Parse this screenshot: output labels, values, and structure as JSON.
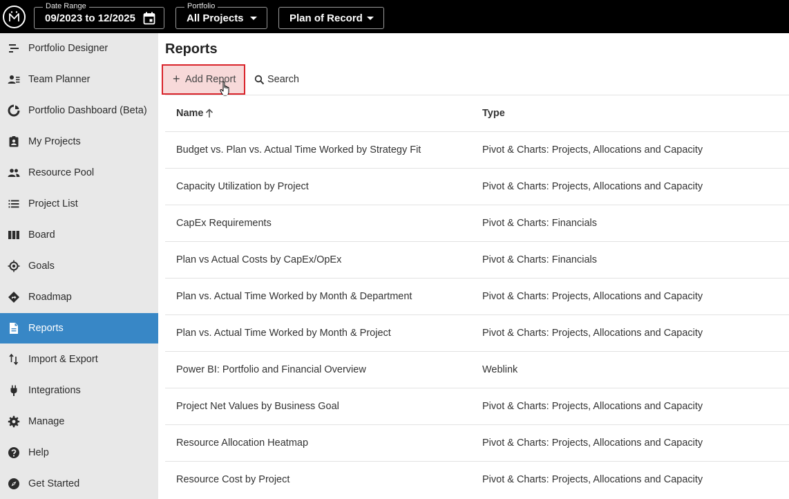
{
  "topbar": {
    "logo_icon": "portfolio-logo-icon",
    "date_range": {
      "label": "Date Range",
      "value": "09/2023 to 12/2025",
      "icon": "calendar-icon"
    },
    "portfolio": {
      "label": "Portfolio",
      "value": "All Projects"
    },
    "scenario": {
      "value": "Plan of Record"
    }
  },
  "sidebar": {
    "active_color": "#3887c6",
    "items": [
      {
        "label": "Portfolio Designer",
        "icon": "portfolio-designer-icon"
      },
      {
        "label": "Team Planner",
        "icon": "team-planner-icon"
      },
      {
        "label": "Portfolio Dashboard (Beta)",
        "icon": "dashboard-icon"
      },
      {
        "label": "My Projects",
        "icon": "my-projects-icon"
      },
      {
        "label": "Resource Pool",
        "icon": "resource-pool-icon"
      },
      {
        "label": "Project List",
        "icon": "project-list-icon"
      },
      {
        "label": "Board",
        "icon": "board-icon"
      },
      {
        "label": "Goals",
        "icon": "goals-icon"
      },
      {
        "label": "Roadmap",
        "icon": "roadmap-icon"
      },
      {
        "label": "Reports",
        "icon": "reports-icon",
        "active": true
      },
      {
        "label": "Import & Export",
        "icon": "import-export-icon"
      },
      {
        "label": "Integrations",
        "icon": "plug-icon"
      },
      {
        "label": "Manage",
        "icon": "gear-icon"
      },
      {
        "label": "Help",
        "icon": "help-icon"
      },
      {
        "label": "Get Started",
        "icon": "compass-icon"
      }
    ]
  },
  "main": {
    "title": "Reports",
    "add_button": "Add Report",
    "search_button": "Search",
    "highlight_color": "#d9232a",
    "table": {
      "columns": [
        "Name",
        "Type"
      ],
      "sort": {
        "column": "Name",
        "direction": "ascending"
      },
      "rows": [
        {
          "name": "Budget vs. Plan vs. Actual Time Worked by Strategy Fit",
          "type": "Pivot & Charts: Projects, Allocations and Capacity"
        },
        {
          "name": "Capacity Utilization by Project",
          "type": "Pivot & Charts: Projects, Allocations and Capacity"
        },
        {
          "name": "CapEx Requirements",
          "type": "Pivot & Charts: Financials"
        },
        {
          "name": "Plan vs Actual Costs by CapEx/OpEx",
          "type": "Pivot & Charts: Financials"
        },
        {
          "name": "Plan vs. Actual Time Worked by Month & Department",
          "type": "Pivot & Charts: Projects, Allocations and Capacity"
        },
        {
          "name": "Plan vs. Actual Time Worked by Month & Project",
          "type": "Pivot & Charts: Projects, Allocations and Capacity"
        },
        {
          "name": "Power BI: Portfolio and Financial Overview",
          "type": "Weblink"
        },
        {
          "name": "Project Net Values by Business Goal",
          "type": "Pivot & Charts: Projects, Allocations and Capacity"
        },
        {
          "name": "Resource Allocation Heatmap",
          "type": "Pivot & Charts: Projects, Allocations and Capacity"
        },
        {
          "name": "Resource Cost by Project",
          "type": "Pivot & Charts: Projects, Allocations and Capacity"
        }
      ]
    }
  }
}
